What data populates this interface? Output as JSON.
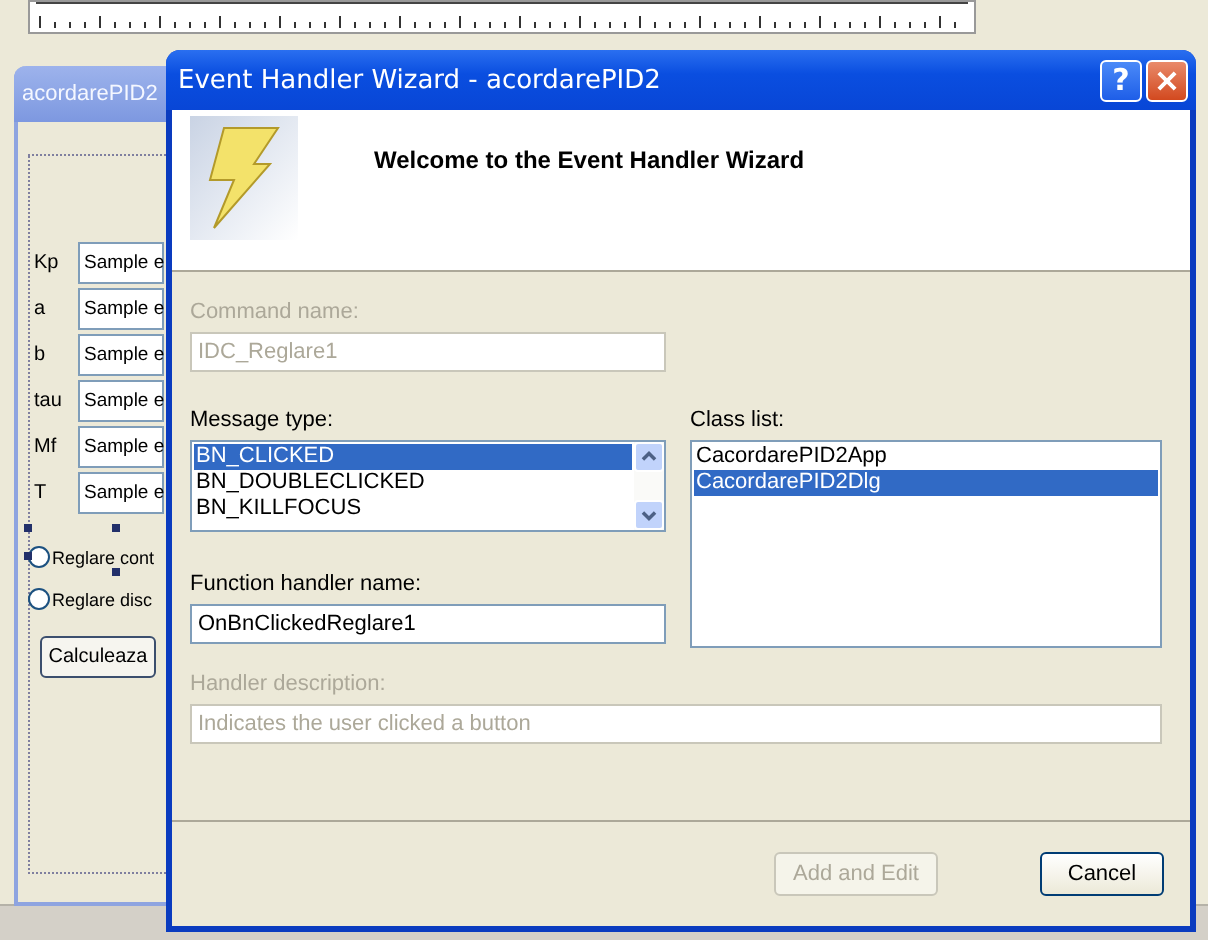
{
  "background_dialog": {
    "title": "acordarePID2",
    "fields": [
      {
        "label": "Kp",
        "value": "Sample e"
      },
      {
        "label": "a",
        "value": "Sample e"
      },
      {
        "label": "b",
        "value": "Sample e"
      },
      {
        "label": "tau",
        "value": "Sample e"
      },
      {
        "label": "Mf",
        "value": "Sample e"
      },
      {
        "label": "T",
        "value": "Sample e"
      }
    ],
    "radios": [
      {
        "label": "Reglare cont",
        "selected": false
      },
      {
        "label": "Reglare disc",
        "selected": false
      }
    ],
    "button": "Calculeaza"
  },
  "wizard": {
    "title": "Event Handler Wizard - acordarePID2",
    "help_button": "?",
    "heading": "Welcome to the Event Handler Wizard",
    "command_name": {
      "label": "Command name:",
      "value": "IDC_Reglare1",
      "disabled": true
    },
    "message_type": {
      "label": "Message type:",
      "items": [
        {
          "text": "BN_CLICKED",
          "selected": true
        },
        {
          "text": "BN_DOUBLECLICKED",
          "selected": false
        },
        {
          "text": "BN_KILLFOCUS",
          "selected": false
        }
      ]
    },
    "class_list": {
      "label": "Class list:",
      "items": [
        {
          "text": "CacordarePID2App",
          "selected": false
        },
        {
          "text": "CacordarePID2Dlg",
          "selected": true
        }
      ]
    },
    "function_handler_name": {
      "label": "Function handler name:",
      "value": "OnBnClickedReglare1",
      "disabled": false
    },
    "handler_description": {
      "label": "Handler description:",
      "value": "Indicates the user clicked a button",
      "disabled": true
    },
    "buttons": [
      {
        "label": "Add and Edit",
        "disabled": true
      },
      {
        "label": "Cancel",
        "disabled": false
      }
    ]
  }
}
